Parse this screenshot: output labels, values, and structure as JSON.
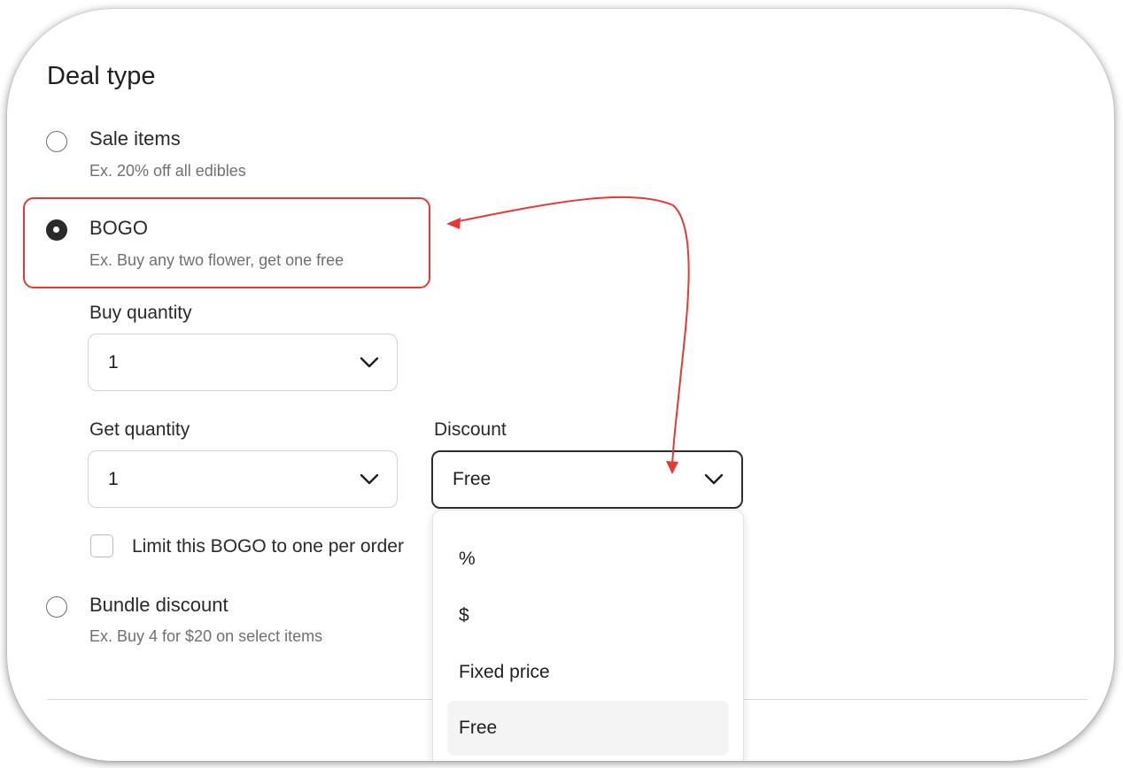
{
  "section": {
    "title": "Deal type"
  },
  "options": [
    {
      "label": "Sale items",
      "desc": "Ex. 20% off all edibles",
      "selected": false
    },
    {
      "label": "BOGO",
      "desc": "Ex. Buy any two flower, get one free",
      "selected": true
    },
    {
      "label": "Bundle discount",
      "desc": "Ex. Buy 4 for $20 on select items",
      "selected": false
    }
  ],
  "bogo": {
    "buy_quantity_label": "Buy quantity",
    "buy_quantity_value": "1",
    "get_quantity_label": "Get quantity",
    "get_quantity_value": "1",
    "discount_label": "Discount",
    "discount_value": "Free",
    "limit_label": "Limit this BOGO to one per order",
    "limit_checked": false
  },
  "discount_menu": {
    "options": [
      "%",
      "$",
      "Fixed price",
      "Free"
    ],
    "highlighted": "Free"
  },
  "colors": {
    "annotation": "#e53935",
    "selected_radio": "#2a2a2a"
  }
}
